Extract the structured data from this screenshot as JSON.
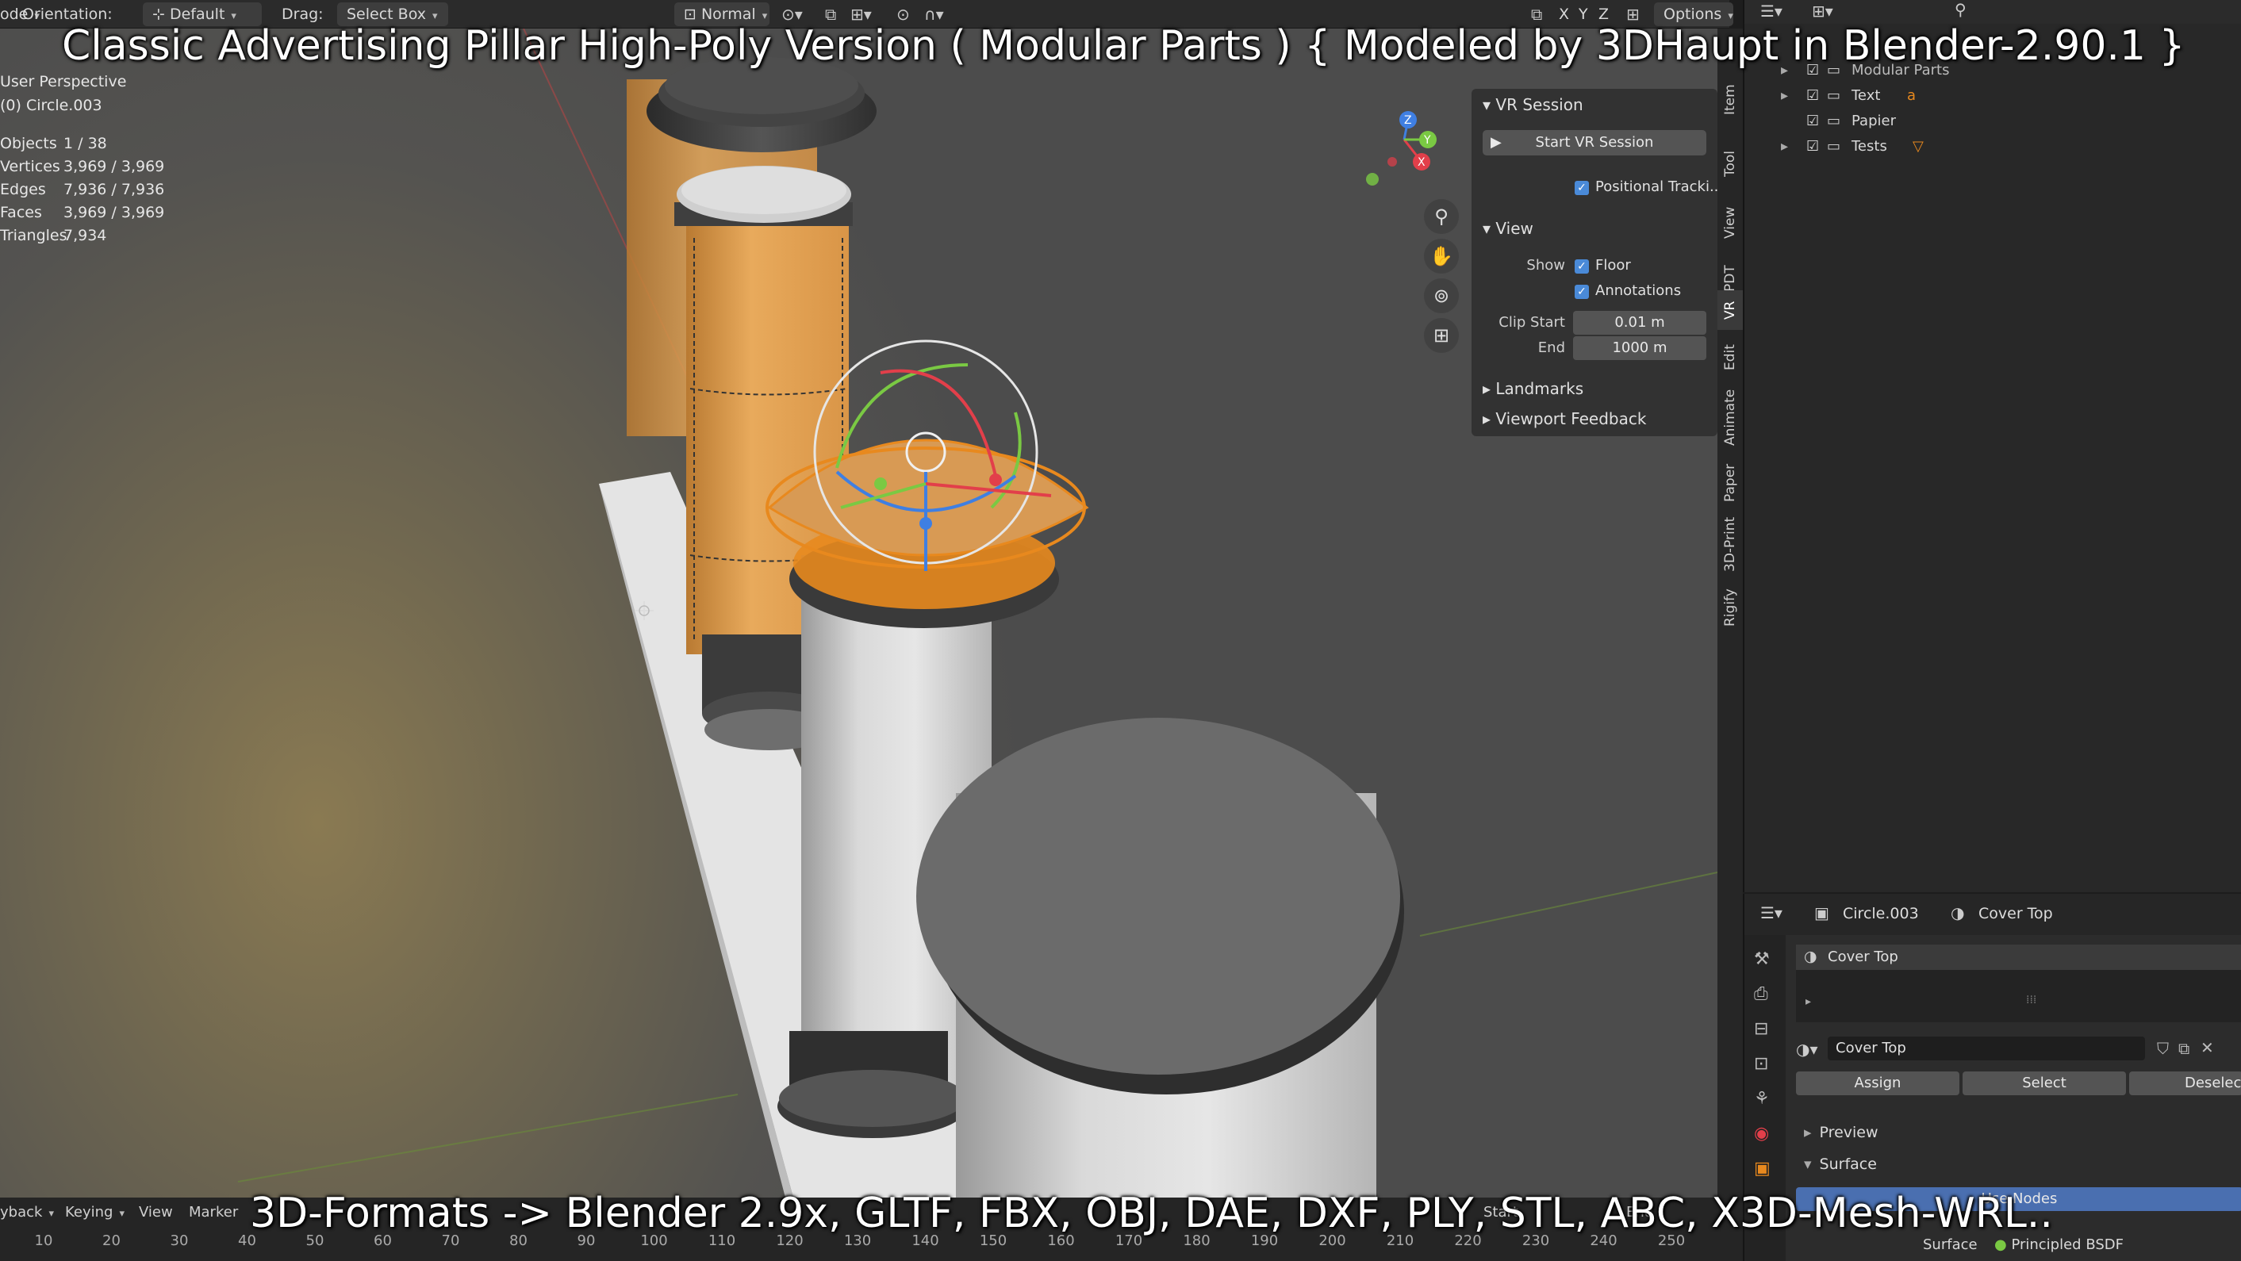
{
  "header": {
    "mode_label": "ode",
    "orientation_label": "Orientation:",
    "orientation_value": "Default",
    "drag_label": "Drag:",
    "drag_value": "Select Box",
    "shading_value": "Normal",
    "axis_x": "X",
    "axis_y": "Y",
    "axis_z": "Z",
    "options_label": "Options"
  },
  "viewport": {
    "view_name": "User Perspective",
    "active_object": "(0) Circle.003",
    "stats": [
      {
        "label": "Objects",
        "value": "1 / 38"
      },
      {
        "label": "Vertices",
        "value": "3,969 / 3,969"
      },
      {
        "label": "Edges",
        "value": "7,936 / 7,936"
      },
      {
        "label": "Faces",
        "value": "3,969 / 3,969"
      },
      {
        "label": "Triangles",
        "value": "7,934"
      }
    ],
    "gizmo_axes": {
      "x": "X",
      "y": "Y",
      "z": "Z"
    }
  },
  "sidebar": {
    "vr_session_header": "VR Session",
    "start_vr_button": "Start VR Session",
    "positional_tracking": "Positional Tracki...",
    "view_header": "View",
    "show_label": "Show",
    "floor_label": "Floor",
    "annotations_label": "Annotations",
    "clip_start_label": "Clip Start",
    "clip_start_value": "0.01 m",
    "clip_end_label": "End",
    "clip_end_value": "1000 m",
    "landmarks_header": "Landmarks",
    "viewport_feedback_header": "Viewport Feedback",
    "tabs": [
      "Item",
      "Tool",
      "View",
      "PDT",
      "VR",
      "Edit",
      "Animate",
      "Paper",
      "3D-Print",
      "Rigify"
    ]
  },
  "outliner": {
    "rows": [
      {
        "label": "Modular Parts"
      },
      {
        "label": "Text"
      },
      {
        "label": "Papier"
      },
      {
        "label": "Tests"
      }
    ]
  },
  "properties": {
    "object_name": "Circle.003",
    "material_name": "Cover Top",
    "slot_name": "Cover Top",
    "datablock_name": "Cover Top",
    "assign_button": "Assign",
    "select_button": "Select",
    "deselect_button": "Deselect",
    "preview_section": "Preview",
    "surface_section": "Surface",
    "use_nodes_button": "Use Nodes",
    "surface_label": "Surface",
    "surface_shader": "Principled BSDF"
  },
  "timeline": {
    "menus": [
      "yback",
      "Keying",
      "View",
      "Marker"
    ],
    "start_label": "Start",
    "end_label": "End",
    "ticks": [
      "10",
      "20",
      "30",
      "40",
      "50",
      "60",
      "70",
      "80",
      "90",
      "100",
      "110",
      "120",
      "130",
      "140",
      "150",
      "160",
      "170",
      "180",
      "190",
      "200",
      "210",
      "220",
      "230",
      "240",
      "250"
    ]
  },
  "overlays": {
    "title": "Classic Advertising Pillar High-Poly Version ( Modular Parts ) { Modeled by 3DHaupt in Blender-2.90.1 }",
    "caption": "3D-Formats -> Blender 2.9x, GLTF, FBX, OBJ, DAE, DXF, PLY, STL, ABC, X3D-Mesh-WRL.."
  },
  "colors": {
    "accent_blue": "#4a8ad8",
    "selection_orange": "#e8891e",
    "pillar_orange": "#e0a55a",
    "axis_x": "#e23f4a",
    "axis_y": "#7ac943",
    "axis_z": "#3f7fe2"
  }
}
